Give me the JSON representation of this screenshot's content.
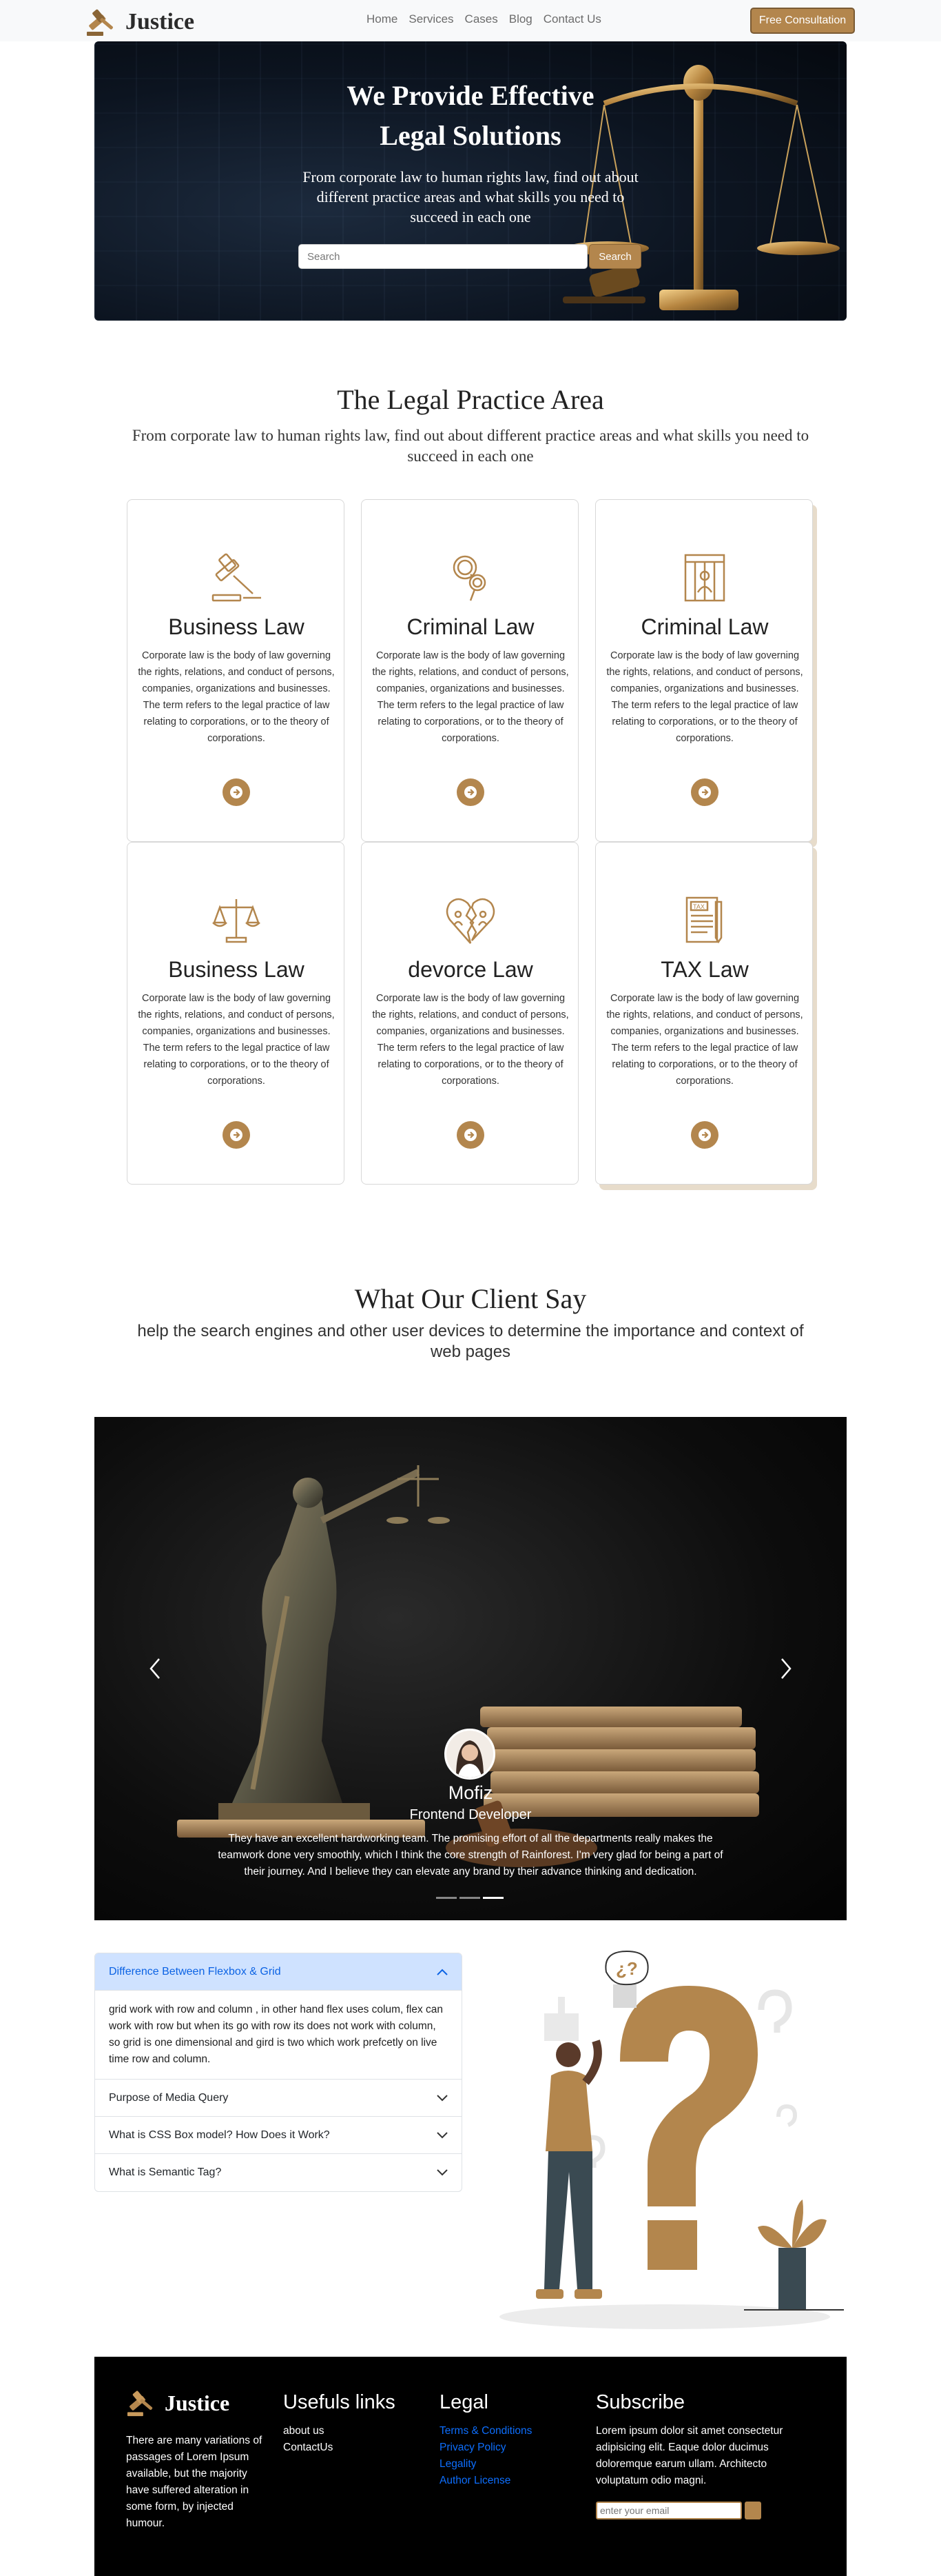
{
  "navbar": {
    "brand": "Justice",
    "links": [
      "Home",
      "Services",
      "Cases",
      "Blog",
      "Contact Us"
    ],
    "cta": "Free Consultation"
  },
  "hero": {
    "title_line1": "We Provide Effective",
    "title_line2": "Legal Solutions",
    "subtitle": "From corporate law to human rights law, find out about different practice areas and what skills you need to succeed in each one",
    "search_placeholder": "Search",
    "search_button": "Search"
  },
  "practice": {
    "title": "The Legal Practice Area",
    "subtitle": "From corporate law to human rights law, find out about different practice areas and what skills you need to succeed in each one",
    "cards": [
      {
        "title": "Business Law",
        "icon": "gavel-icon",
        "text": "Corporate law is the body of law governing the rights, relations, and conduct of persons, companies, organizations and businesses. The term refers to the legal practice of law relating to corporations, or to the theory of corporations."
      },
      {
        "title": "Criminal Law",
        "icon": "handcuffs-icon",
        "text": "Corporate law is the body of law governing the rights, relations, and conduct of persons, companies, organizations and businesses. The term refers to the legal practice of law relating to corporations, or to the theory of corporations."
      },
      {
        "title": "Criminal Law",
        "icon": "prisoner-icon",
        "text": "Corporate law is the body of law governing the rights, relations, and conduct of persons, companies, organizations and businesses. The term refers to the legal practice of law relating to corporations, or to the theory of corporations."
      },
      {
        "title": "Business Law",
        "icon": "scales-icon",
        "text": "Corporate law is the body of law governing the rights, relations, and conduct of persons, companies, organizations and businesses. The term refers to the legal practice of law relating to corporations, or to the theory of corporations."
      },
      {
        "title": "devorce Law",
        "icon": "broken-heart-icon",
        "text": "Corporate law is the body of law governing the rights, relations, and conduct of persons, companies, organizations and businesses. The term refers to the legal practice of law relating to corporations, or to the theory of corporations."
      },
      {
        "title": "TAX Law",
        "icon": "tax-document-icon",
        "text": "Corporate law is the body of law governing the rights, relations, and conduct of persons, companies, organizations and businesses. The term refers to the legal practice of law relating to corporations, or to the theory of corporations."
      }
    ]
  },
  "testimonials": {
    "title": "What Our Client Say",
    "subtitle": "help the search engines and other user devices to determine the importance and context of web pages",
    "name": "Mofiz",
    "role": "Frontend Developer",
    "text": "They have an excellent hardworking team. The promising effort of all the departments really makes the teamwork done very smoothly, which I think the core strength of Rainforest. I'm very glad for being a part of their journey. And I believe they can elevate any brand by their advance thinking and dedication.",
    "slide_count": 3,
    "active_slide": 3
  },
  "faq": {
    "items": [
      {
        "question": "Difference Between Flexbox & Grid",
        "open": true,
        "answer": "grid work with row and column , in other hand flex uses colum, flex can work with row but when its go with row its does not work with column, so grid is one dimensional and gird is two which work prefcetly on live time row and column."
      },
      {
        "question": "Purpose of Media Query",
        "open": false
      },
      {
        "question": "What is CSS Box model? How Does it Work?",
        "open": false
      },
      {
        "question": "What is Semantic Tag?",
        "open": false
      }
    ]
  },
  "footer": {
    "brand": "Justice",
    "about": "There are many variations of passages of Lorem Ipsum available, but the majority have suffered alteration in some form, by injected humour.",
    "useful_title": "Usefuls links",
    "useful_links": [
      "about us",
      "ContactUs"
    ],
    "legal_title": "Legal",
    "legal_links": [
      "Terms & Conditions",
      "Privacy Policy",
      "Legality",
      "Author License"
    ],
    "subscribe_title": "Subscribe",
    "subscribe_text": "Lorem ipsum dolor sit amet consectetur adipisicing elit. Eaque dolor ducimus doloremque earum ullam. Architecto voluptatum odio magni.",
    "email_placeholder": "enter your email"
  },
  "colors": {
    "accent": "#b3864d",
    "link_blue": "#0d6efd",
    "faq_open_bg": "#cfe2ff"
  }
}
